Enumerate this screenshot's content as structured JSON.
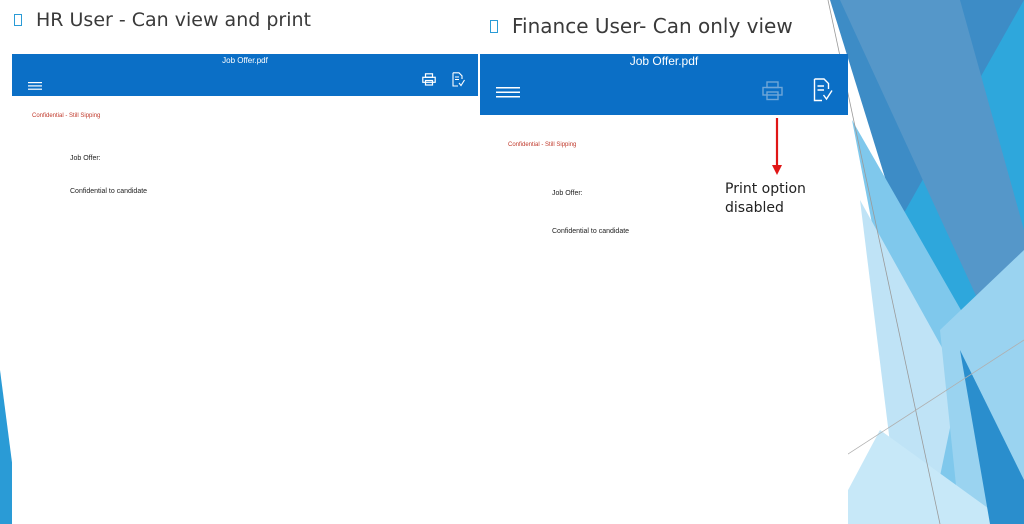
{
  "slide": {
    "colors": {
      "toolbar": "#0b6fc6",
      "accent": "#2a9bd6",
      "confidential": "#c0392b",
      "callout_arrow": "#e01616"
    }
  },
  "hr_panel": {
    "heading": "HR User - Can view and print",
    "viewer": {
      "file_title": "Job Offer.pdf",
      "icons": [
        "menu-icon",
        "print-icon",
        "annotate-icon"
      ],
      "print_enabled": true,
      "document": {
        "confidential_label": "Confidential - Still Sipping",
        "line_1": "Job Offer:",
        "line_2": "Confidential to candidate"
      }
    }
  },
  "finance_panel": {
    "heading": "Finance User- Can only view",
    "viewer": {
      "file_title": "Job Offer.pdf",
      "icons": [
        "menu-icon",
        "print-icon",
        "annotate-icon"
      ],
      "print_enabled": false,
      "document": {
        "confidential_label": "Confidential - Still Sipping",
        "line_1": "Job Offer:",
        "line_2": "Confidential to candidate"
      }
    },
    "callout": "Print option disabled"
  }
}
